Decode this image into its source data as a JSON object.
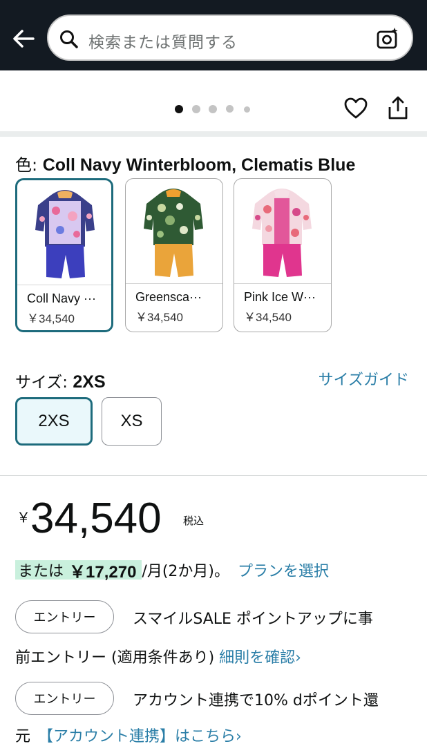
{
  "search": {
    "placeholder": "検索または質問する"
  },
  "icons": {
    "back": "back-arrow-icon",
    "search": "search-icon",
    "camera": "camera-search-icon",
    "heart": "heart-icon",
    "share": "share-icon"
  },
  "colors": {
    "header_bg": "#131a22",
    "selected_border": "#1d6b7c",
    "link": "#2a7ea7",
    "installment_highlight": "#c9f0dd"
  },
  "gallery": {
    "dot_count": 5,
    "active_dot": 0
  },
  "color_selector": {
    "label": "色: ",
    "selected_name": "Coll Navy Winterbloom, Clematis Blue",
    "options": [
      {
        "name": "Coll Navy ···",
        "price": "￥34,540",
        "selected": true
      },
      {
        "name": "Greensca···",
        "price": "￥34,540",
        "selected": false
      },
      {
        "name": "Pink Ice W···",
        "price": "￥34,540",
        "selected": false
      }
    ]
  },
  "size_selector": {
    "label": "サイズ: ",
    "selected": "2XS",
    "guide_link": "サイズガイド",
    "options": [
      {
        "label": "2XS",
        "selected": true
      },
      {
        "label": "XS",
        "selected": false
      }
    ]
  },
  "price": {
    "currency": "￥",
    "amount": "34,540",
    "tax_note": "税込"
  },
  "installment": {
    "prefix": "または",
    "amount": "￥17,270",
    "suffix": "/月(2か月)。",
    "plan_link": "プランを選択"
  },
  "promos": [
    {
      "pill": "エントリー",
      "line1": "スマイルSALE ポイントアップに事",
      "line2": "前エントリー (適用条件あり)",
      "link": "細則を確認›"
    },
    {
      "pill": "エントリー",
      "line1": "アカウント連携で10% dポイント還",
      "line2": "元",
      "link": "【アカウント連携】はこちら›"
    }
  ]
}
